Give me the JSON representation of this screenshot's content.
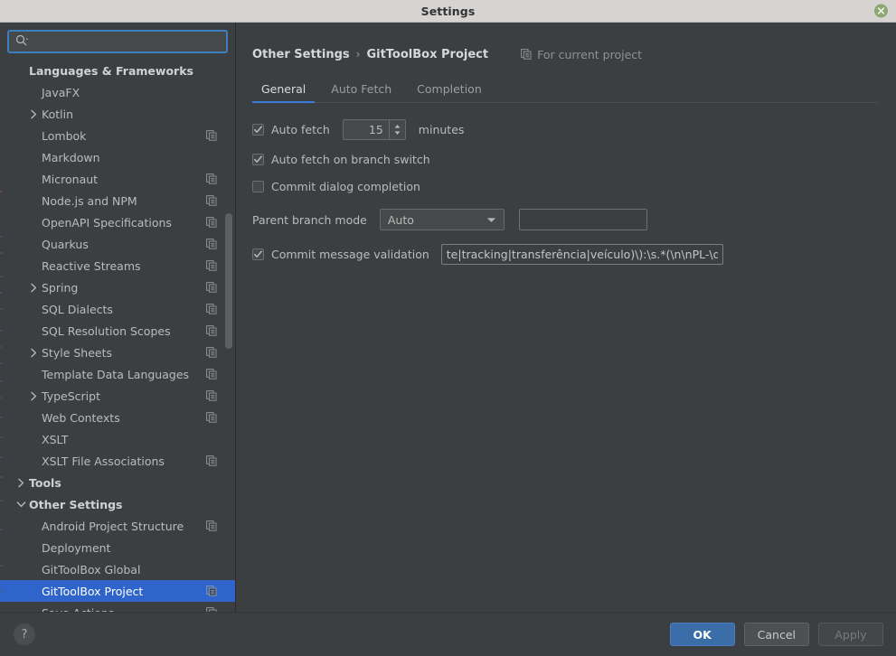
{
  "window": {
    "title": "Settings",
    "close_icon": "close-icon"
  },
  "sidebar": {
    "search": {
      "placeholder": "",
      "value": "",
      "icon": "search-icon"
    },
    "items": [
      {
        "label": "Languages & Frameworks",
        "indent": 0,
        "group": true,
        "arrow": "",
        "scope_icon": false
      },
      {
        "label": "JavaFX",
        "indent": 1,
        "group": false,
        "arrow": "",
        "scope_icon": false
      },
      {
        "label": "Kotlin",
        "indent": 1,
        "group": false,
        "arrow": ">",
        "scope_icon": false
      },
      {
        "label": "Lombok",
        "indent": 1,
        "group": false,
        "arrow": "",
        "scope_icon": true
      },
      {
        "label": "Markdown",
        "indent": 1,
        "group": false,
        "arrow": "",
        "scope_icon": false
      },
      {
        "label": "Micronaut",
        "indent": 1,
        "group": false,
        "arrow": "",
        "scope_icon": true
      },
      {
        "label": "Node.js and NPM",
        "indent": 1,
        "group": false,
        "arrow": "",
        "scope_icon": true
      },
      {
        "label": "OpenAPI Specifications",
        "indent": 1,
        "group": false,
        "arrow": "",
        "scope_icon": true
      },
      {
        "label": "Quarkus",
        "indent": 1,
        "group": false,
        "arrow": "",
        "scope_icon": true
      },
      {
        "label": "Reactive Streams",
        "indent": 1,
        "group": false,
        "arrow": "",
        "scope_icon": true
      },
      {
        "label": "Spring",
        "indent": 1,
        "group": false,
        "arrow": ">",
        "scope_icon": true
      },
      {
        "label": "SQL Dialects",
        "indent": 1,
        "group": false,
        "arrow": "",
        "scope_icon": true
      },
      {
        "label": "SQL Resolution Scopes",
        "indent": 1,
        "group": false,
        "arrow": "",
        "scope_icon": true
      },
      {
        "label": "Style Sheets",
        "indent": 1,
        "group": false,
        "arrow": ">",
        "scope_icon": true
      },
      {
        "label": "Template Data Languages",
        "indent": 1,
        "group": false,
        "arrow": "",
        "scope_icon": true
      },
      {
        "label": "TypeScript",
        "indent": 1,
        "group": false,
        "arrow": ">",
        "scope_icon": true
      },
      {
        "label": "Web Contexts",
        "indent": 1,
        "group": false,
        "arrow": "",
        "scope_icon": true
      },
      {
        "label": "XSLT",
        "indent": 1,
        "group": false,
        "arrow": "",
        "scope_icon": false
      },
      {
        "label": "XSLT File Associations",
        "indent": 1,
        "group": false,
        "arrow": "",
        "scope_icon": true
      },
      {
        "label": "Tools",
        "indent": 0,
        "group": true,
        "arrow": ">",
        "scope_icon": false
      },
      {
        "label": "Other Settings",
        "indent": 0,
        "group": true,
        "arrow": "v",
        "scope_icon": false
      },
      {
        "label": "Android Project Structure",
        "indent": 1,
        "group": false,
        "arrow": "",
        "scope_icon": true
      },
      {
        "label": "Deployment",
        "indent": 1,
        "group": false,
        "arrow": "",
        "scope_icon": false
      },
      {
        "label": "GitToolBox Global",
        "indent": 1,
        "group": false,
        "arrow": "",
        "scope_icon": false
      },
      {
        "label": "GitToolBox Project",
        "indent": 1,
        "group": false,
        "arrow": "",
        "scope_icon": true,
        "selected": true
      },
      {
        "label": "Save Actions",
        "indent": 1,
        "group": false,
        "arrow": "",
        "scope_icon": true
      }
    ],
    "selected_label": "GitToolBox Project"
  },
  "panel": {
    "breadcrumb": {
      "parent": "Other Settings",
      "separator": "›",
      "current": "GitToolBox Project"
    },
    "scope_note": {
      "text": "For current project",
      "icon": "project-scope-icon"
    },
    "tabs": [
      {
        "label": "General",
        "active": true
      },
      {
        "label": "Auto Fetch",
        "active": false
      },
      {
        "label": "Completion",
        "active": false
      }
    ],
    "form": {
      "auto_fetch": {
        "label": "Auto fetch",
        "checked": true,
        "interval_value": "15",
        "unit_label": "minutes"
      },
      "auto_fetch_on_branch_switch": {
        "label": "Auto fetch on branch switch",
        "checked": true
      },
      "commit_dialog_completion": {
        "label": "Commit dialog completion",
        "checked": false
      },
      "parent_branch_mode": {
        "label": "Parent branch mode",
        "value": "Auto",
        "options": [
          "Auto"
        ],
        "extra_field_value": "",
        "extra_field_placeholder": ""
      },
      "commit_message_validation": {
        "label": "Commit message validation",
        "checked": true,
        "value": "te|tracking|transferência|veículo)\\):\\s.*(\\n\\nPL-\\d+)?"
      }
    }
  },
  "footer": {
    "help_label": "?",
    "ok_label": "OK",
    "cancel_label": "Cancel",
    "apply_label": "Apply",
    "apply_disabled": true
  },
  "colors": {
    "accent_blue": "#3b7dd8",
    "selection_blue": "#2f65ca",
    "primary_button": "#3b6ea8",
    "panel_bg": "#3c3f41",
    "titlebar_bg": "#d6d3d1",
    "close_button": "#8aa872"
  }
}
